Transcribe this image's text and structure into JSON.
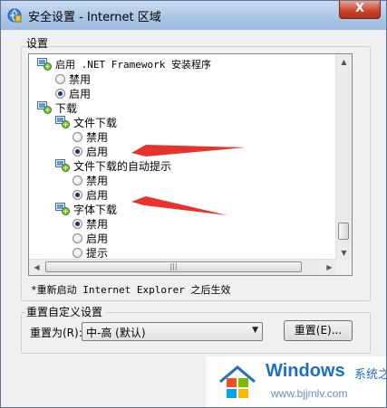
{
  "window": {
    "title": "安全设置 - Internet 区域",
    "close_label": "X"
  },
  "settings": {
    "group_label": "设置",
    "items": [
      {
        "type": "setting",
        "label": "启用 .NET Framework 安装程序",
        "icon": "setting-icon"
      },
      {
        "type": "radio",
        "label": "禁用",
        "checked": false
      },
      {
        "type": "radio",
        "label": "启用",
        "checked": true
      },
      {
        "type": "category",
        "label": "下载",
        "icon": "setting-icon"
      },
      {
        "type": "setting",
        "label": "文件下载",
        "icon": "setting-icon"
      },
      {
        "type": "radio",
        "label": "禁用",
        "checked": false
      },
      {
        "type": "radio",
        "label": "启用",
        "checked": true
      },
      {
        "type": "setting",
        "label": "文件下载的自动提示",
        "icon": "setting-icon"
      },
      {
        "type": "radio",
        "label": "禁用",
        "checked": false
      },
      {
        "type": "radio",
        "label": "启用",
        "checked": true
      },
      {
        "type": "setting",
        "label": "字体下载",
        "icon": "setting-icon"
      },
      {
        "type": "radio",
        "label": "禁用",
        "checked": true
      },
      {
        "type": "radio",
        "label": "启用",
        "checked": false
      },
      {
        "type": "radio",
        "label": "提示",
        "checked": false
      }
    ]
  },
  "restart_note": "*重新启动 Internet Explorer 之后生效",
  "reset": {
    "group_label": "重置自定义设置",
    "reset_to_label": "重置为(R):",
    "selected_value": "中-高 (默认)",
    "reset_button": "重置(E)..."
  },
  "watermark": {
    "brand": "Windows",
    "cn": "系统之家",
    "url": "www.bjjmlv.com"
  },
  "colors": {
    "arrow": "#e8332c",
    "title_bar": "#aac5e4",
    "watermark": "#1d6fc0"
  }
}
